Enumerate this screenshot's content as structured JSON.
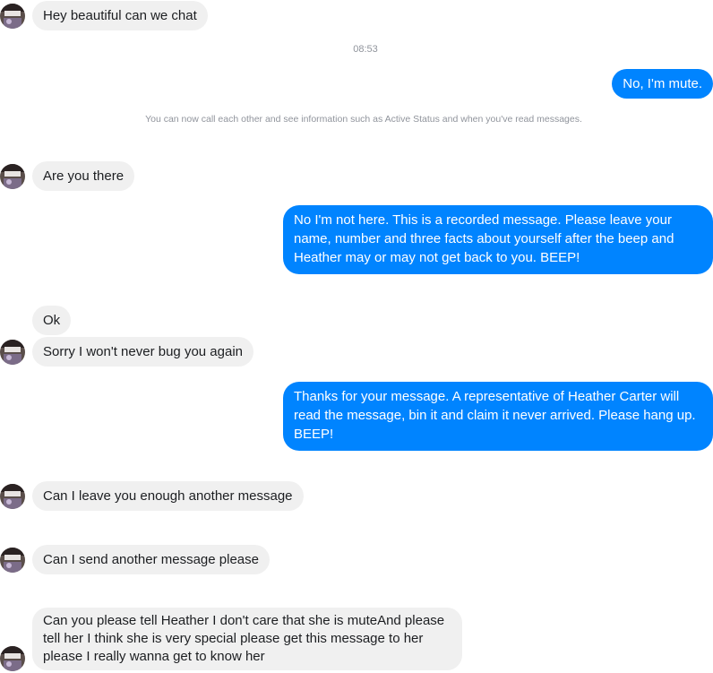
{
  "conversation": {
    "timestamp": "08:53",
    "notice": "You can now call each other and see information such as Active Status and when you've read messages.",
    "messages": [
      {
        "from": "them",
        "text": "Hey beautiful can we chat"
      },
      {
        "from": "me",
        "text": "No, I'm mute."
      },
      {
        "from": "them",
        "text": "Are you there"
      },
      {
        "from": "me",
        "text": "No I'm not here. This is a recorded message. Please leave your name, number and three facts about yourself after the beep and Heather may or may not get back to you. BEEP!"
      },
      {
        "from": "them",
        "text": "Ok"
      },
      {
        "from": "them",
        "text": "Sorry I won't never bug you again"
      },
      {
        "from": "me",
        "text": "Thanks for your message. A representative of Heather Carter will read the message, bin it and claim it never arrived. Please hang up. BEEP!"
      },
      {
        "from": "them",
        "text": "Can I leave you enough another message"
      },
      {
        "from": "them",
        "text": "Can I send another message please"
      },
      {
        "from": "them",
        "text": "Can you please tell Heather I don't care that she is muteAnd please tell her I think she is very special please get this message to her please I really wanna get to know her"
      }
    ]
  },
  "colors": {
    "outgoing_bubble": "#0084ff",
    "incoming_bubble": "#f0f0f0",
    "meta_text": "#90949c"
  },
  "icons": {
    "avatar": "contact-avatar"
  }
}
